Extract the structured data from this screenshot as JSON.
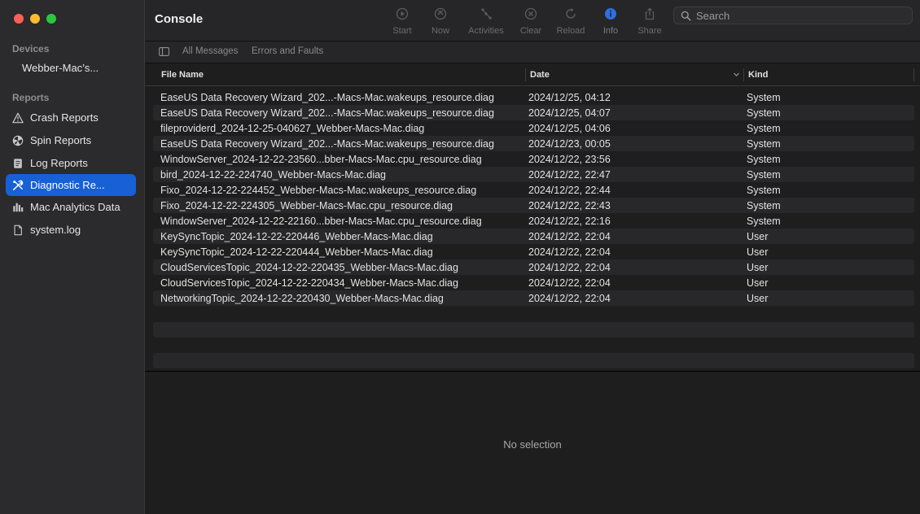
{
  "app": {
    "title": "Console"
  },
  "sidebar": {
    "devices_heading": "Devices",
    "device_name": "Webber-Mac’s...",
    "reports_heading": "Reports",
    "items": [
      {
        "label": "Crash Reports",
        "icon": "warning-icon"
      },
      {
        "label": "Spin Reports",
        "icon": "spin-icon"
      },
      {
        "label": "Log Reports",
        "icon": "log-icon"
      },
      {
        "label": "Diagnostic Re...",
        "icon": "tools-icon",
        "selected": true
      },
      {
        "label": "Mac Analytics Data",
        "icon": "chart-icon"
      },
      {
        "label": "system.log",
        "icon": "document-icon"
      }
    ]
  },
  "toolbar": {
    "buttons": [
      {
        "label": "Start",
        "icon": "play-icon"
      },
      {
        "label": "Now",
        "icon": "now-icon"
      },
      {
        "label": "Activities",
        "icon": "activities-icon"
      },
      {
        "label": "Clear",
        "icon": "clear-icon"
      },
      {
        "label": "Reload",
        "icon": "reload-icon"
      },
      {
        "label": "Info",
        "icon": "info-icon"
      },
      {
        "label": "Share",
        "icon": "share-icon"
      }
    ],
    "search_placeholder": "Search"
  },
  "filters": {
    "all_messages": "All Messages",
    "errors_faults": "Errors and Faults"
  },
  "table": {
    "columns": {
      "file_name": "File Name",
      "date": "Date",
      "kind": "Kind"
    },
    "rows": [
      [
        "EaseUS Data Recovery Wizard_202...-Macs-Mac.wakeups_resource.diag",
        "2024/12/25, 04:12",
        "System"
      ],
      [
        "EaseUS Data Recovery Wizard_202...-Macs-Mac.wakeups_resource.diag",
        "2024/12/25, 04:07",
        "System"
      ],
      [
        "fileproviderd_2024-12-25-040627_Webber-Macs-Mac.diag",
        "2024/12/25, 04:06",
        "System"
      ],
      [
        "EaseUS Data Recovery Wizard_202...-Macs-Mac.wakeups_resource.diag",
        "2024/12/23, 00:05",
        "System"
      ],
      [
        "WindowServer_2024-12-22-23560...bber-Macs-Mac.cpu_resource.diag",
        "2024/12/22, 23:56",
        "System"
      ],
      [
        "bird_2024-12-22-224740_Webber-Macs-Mac.diag",
        "2024/12/22, 22:47",
        "System"
      ],
      [
        "Fixo_2024-12-22-224452_Webber-Macs-Mac.wakeups_resource.diag",
        "2024/12/22, 22:44",
        "System"
      ],
      [
        "Fixo_2024-12-22-224305_Webber-Macs-Mac.cpu_resource.diag",
        "2024/12/22, 22:43",
        "System"
      ],
      [
        "WindowServer_2024-12-22-22160...bber-Macs-Mac.cpu_resource.diag",
        "2024/12/22, 22:16",
        "System"
      ],
      [
        "KeySyncTopic_2024-12-22-220446_Webber-Macs-Mac.diag",
        "2024/12/22, 22:04",
        "User"
      ],
      [
        "KeySyncTopic_2024-12-22-220444_Webber-Macs-Mac.diag",
        "2024/12/22, 22:04",
        "User"
      ],
      [
        "CloudServicesTopic_2024-12-22-220435_Webber-Macs-Mac.diag",
        "2024/12/22, 22:04",
        "User"
      ],
      [
        "CloudServicesTopic_2024-12-22-220434_Webber-Macs-Mac.diag",
        "2024/12/22, 22:04",
        "User"
      ],
      [
        "NetworkingTopic_2024-12-22-220430_Webber-Macs-Mac.diag",
        "2024/12/22, 22:04",
        "User"
      ]
    ]
  },
  "detail": {
    "empty_text": "No selection"
  },
  "colors": {
    "selection": "#1760d6",
    "info_accent": "#2f6fe0"
  }
}
